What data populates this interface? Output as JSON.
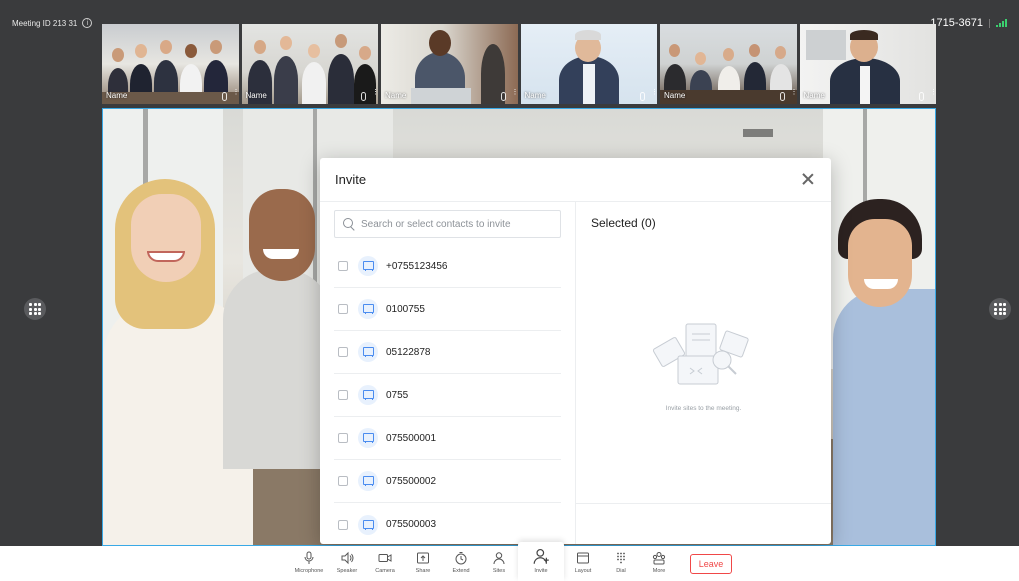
{
  "meeting": {
    "id_label": "Meeting ID 213 31",
    "code": "1715-3671",
    "info_icon": "info-icon",
    "signal_icon": "signal-bars-icon"
  },
  "thumbnails": [
    {
      "name": "Name"
    },
    {
      "name": "Name"
    },
    {
      "name": "Name"
    },
    {
      "name": "Name"
    },
    {
      "name": "Name"
    },
    {
      "name": "Name"
    }
  ],
  "dialog": {
    "title": "Invite",
    "search_placeholder": "Search or select contacts to invite",
    "selected_title": "Selected (0)",
    "empty_text": "Invite sites to the meeting.",
    "contacts": [
      {
        "label": "+0755123456"
      },
      {
        "label": "0100755"
      },
      {
        "label": "05122878"
      },
      {
        "label": "0755"
      },
      {
        "label": "075500001"
      },
      {
        "label": "075500002"
      },
      {
        "label": "075500003"
      }
    ]
  },
  "toolbar": {
    "items": [
      {
        "label": "Microphone",
        "icon": "microphone-icon"
      },
      {
        "label": "Speaker",
        "icon": "speaker-icon"
      },
      {
        "label": "Camera",
        "icon": "camera-icon"
      },
      {
        "label": "Share",
        "icon": "share-icon"
      },
      {
        "label": "Extend",
        "icon": "timer-icon"
      },
      {
        "label": "Sites",
        "icon": "person-icon"
      },
      {
        "label": "Invite",
        "icon": "add-person-icon"
      },
      {
        "label": "Layout",
        "icon": "layout-icon"
      },
      {
        "label": "Dial",
        "icon": "dialpad-icon"
      },
      {
        "label": "More",
        "icon": "group-icon"
      }
    ],
    "leave_label": "Leave"
  },
  "colors": {
    "accent": "#39a9e6",
    "leave": "#f04848",
    "contact_icon": "#4a8cf0",
    "background": "#3a3b3d"
  }
}
